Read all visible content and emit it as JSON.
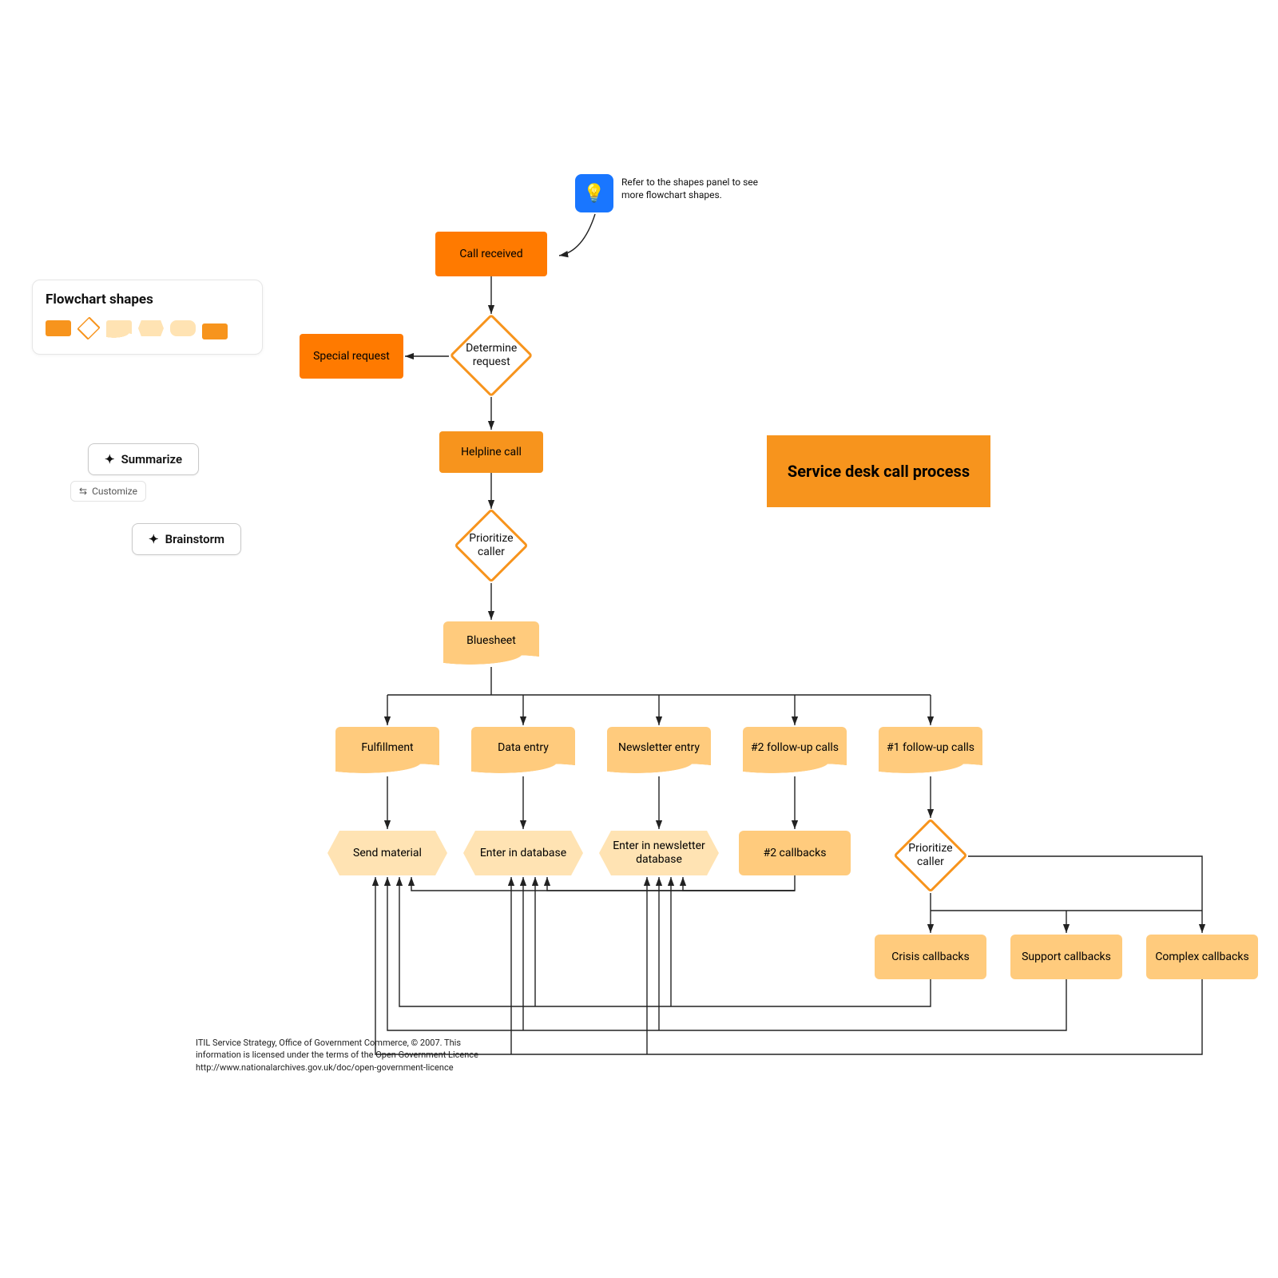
{
  "panel": {
    "title": "Flowchart shapes",
    "summarize": "Summarize",
    "customize": "Customize",
    "brainstorm": "Brainstorm"
  },
  "tip": {
    "text": "Refer to the shapes panel to see more flowchart shapes."
  },
  "title_card": "Service desk call process",
  "nodes": {
    "call_received": "Call received",
    "determine_request": "Determine request",
    "special_request": "Special request",
    "helpline_call": "Helpline call",
    "prioritize_caller_1": "Prioritize caller",
    "bluesheet": "Bluesheet",
    "fulfillment": "Fulfillment",
    "data_entry": "Data entry",
    "newsletter_entry": "Newsletter entry",
    "follow2": "#2 follow-up calls",
    "follow1": "#1 follow-up calls",
    "send_material": "Send material",
    "enter_db": "Enter in database",
    "enter_news_db": "Enter in newsletter database",
    "cb2": "#2 callbacks",
    "prioritize_caller_2": "Prioritize caller",
    "crisis": "Crisis callbacks",
    "support": "Support callbacks",
    "complex": "Complex callbacks"
  },
  "citation": "ITIL Service Strategy, Office of Government Commerce, © 2007. This information is licensed under the terms of the Open Government Licence http://www.nationalarchives.gov.uk/doc/open-government-licence"
}
